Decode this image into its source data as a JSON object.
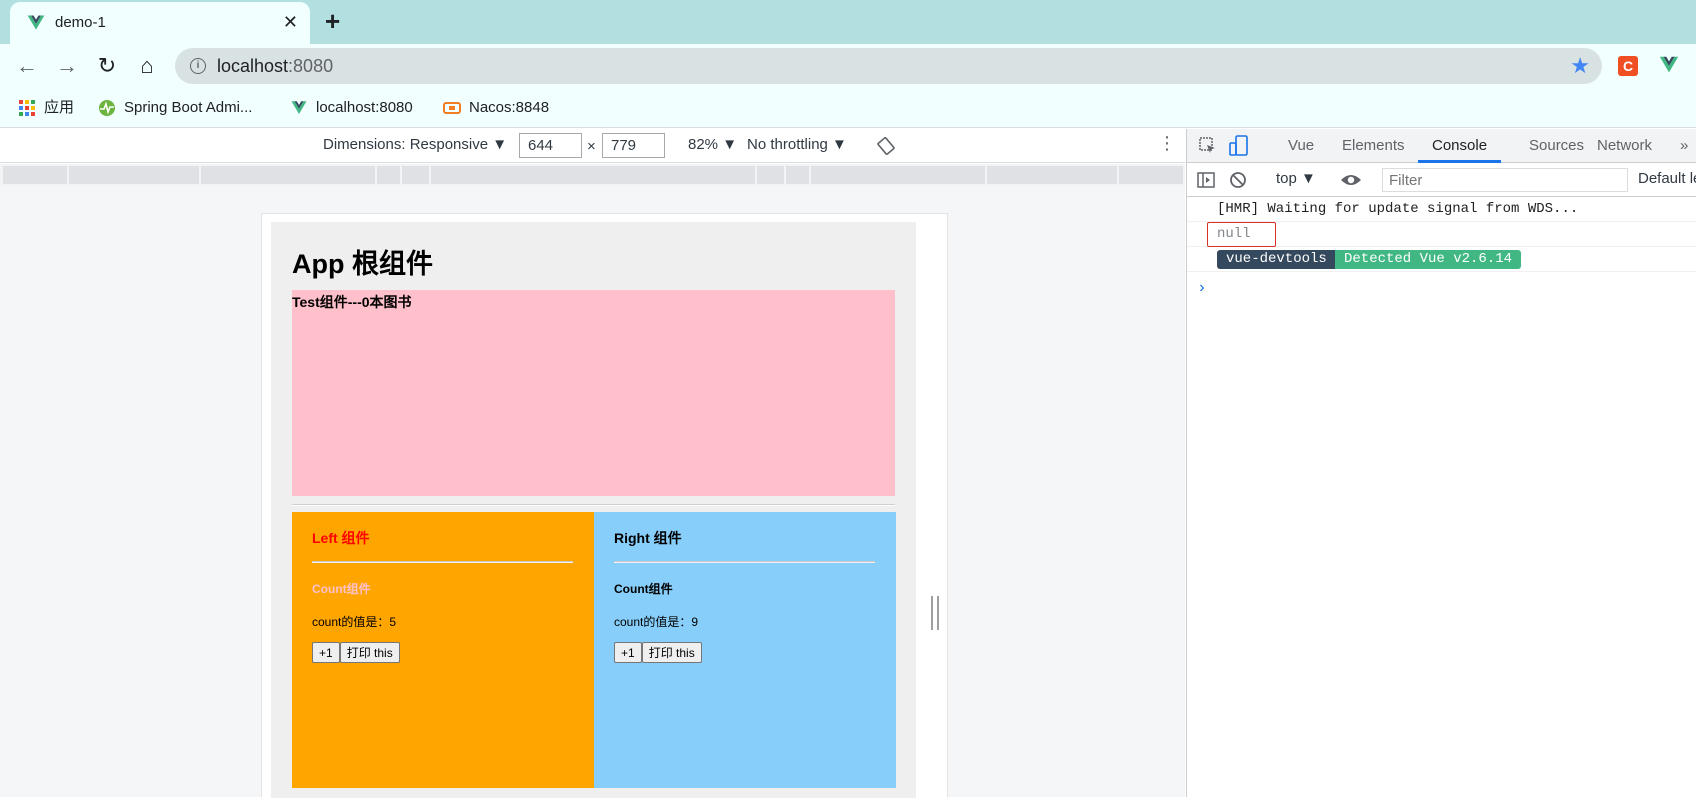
{
  "browser": {
    "tab_title": "demo-1",
    "tab_close": "✕",
    "new_tab": "+",
    "url_host": "localhost",
    "url_port": ":8080",
    "bookmarks": [
      {
        "label": "应用",
        "icon": "apps-grid-icon"
      },
      {
        "label": "Spring Boot Admi...",
        "icon": "spring-boot-admin-icon"
      },
      {
        "label": "localhost:8080",
        "icon": "vue-icon"
      },
      {
        "label": "Nacos:8848",
        "icon": "nacos-icon"
      }
    ],
    "extension_c": "C"
  },
  "device_toolbar": {
    "dimensions_label": "Dimensions: Responsive ▼",
    "width": "644",
    "times": "×",
    "height": "779",
    "zoom": "82% ▼",
    "throttling": "No throttling ▼"
  },
  "page": {
    "app_title": "App 根组件",
    "test_title": "Test组件---0本图书",
    "left": {
      "title": "Left 组件",
      "count_title": "Count组件",
      "count_value": "count的值是：5",
      "inc_button": "+1",
      "print_button": "打印 this",
      "title_color": "#ff0000",
      "count_title_color": "#ffc0cb",
      "bg": "#ffa500"
    },
    "right": {
      "title": "Right 组件",
      "count_title": "Count组件",
      "count_value": "count的值是：9",
      "inc_button": "+1",
      "print_button": "打印 this",
      "bg": "#87cefa"
    },
    "test_bg": "#ffc0cb"
  },
  "devtools": {
    "tabs": [
      "Vue",
      "Elements",
      "Console",
      "Sources",
      "Network"
    ],
    "active_tab": "Console",
    "more": "»",
    "context": "top ▼",
    "filter_placeholder": "Filter",
    "levels": "Default le",
    "console": {
      "line1": "[HMR] Waiting for update signal from WDS...",
      "line2": "null",
      "badge_left": "vue-devtools",
      "badge_right": "Detected Vue v2.6.14",
      "prompt": "›"
    }
  }
}
